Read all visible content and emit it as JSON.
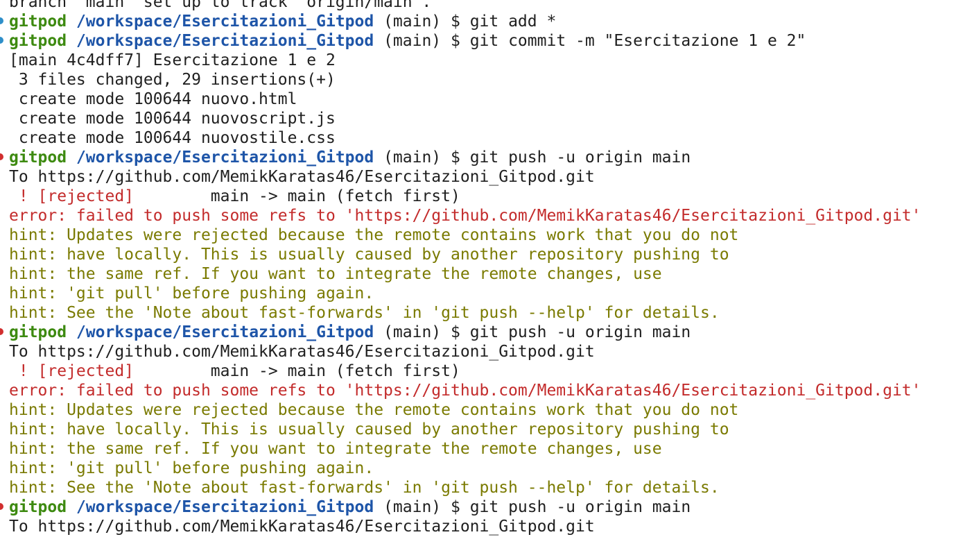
{
  "lines": [
    {
      "kind": "output",
      "text": "branch 'main' set up to track 'origin/main'."
    },
    {
      "kind": "prompt",
      "status": "ok",
      "user": "gitpod",
      "path": "/workspace/Esercitazioni_Gitpod",
      "rest": " (main) $ git add *"
    },
    {
      "kind": "prompt",
      "status": "ok",
      "user": "gitpod",
      "path": "/workspace/Esercitazioni_Gitpod",
      "rest": " (main) $ git commit -m \"Esercitazione 1 e 2\""
    },
    {
      "kind": "output",
      "text": "[main 4c4dff7] Esercitazione 1 e 2"
    },
    {
      "kind": "output",
      "text": " 3 files changed, 29 insertions(+)"
    },
    {
      "kind": "output",
      "text": " create mode 100644 nuovo.html"
    },
    {
      "kind": "output",
      "text": " create mode 100644 nuovoscript.js"
    },
    {
      "kind": "output",
      "text": " create mode 100644 nuovostile.css"
    },
    {
      "kind": "prompt",
      "status": "error",
      "user": "gitpod",
      "path": "/workspace/Esercitazioni_Gitpod",
      "rest": " (main) $ git push -u origin main"
    },
    {
      "kind": "output",
      "text": "To https://github.com/MemikKaratas46/Esercitazioni_Gitpod.git"
    },
    {
      "kind": "rejected",
      "tag": " ! [rejected]",
      "text": "        main -> main (fetch first)"
    },
    {
      "kind": "error",
      "text": "error: failed to push some refs to 'https://github.com/MemikKaratas46/Esercitazioni_Gitpod.git'"
    },
    {
      "kind": "hint",
      "text": "hint: Updates were rejected because the remote contains work that you do not"
    },
    {
      "kind": "hint",
      "text": "hint: have locally. This is usually caused by another repository pushing to"
    },
    {
      "kind": "hint",
      "text": "hint: the same ref. If you want to integrate the remote changes, use"
    },
    {
      "kind": "hint",
      "text": "hint: 'git pull' before pushing again."
    },
    {
      "kind": "hint",
      "text": "hint: See the 'Note about fast-forwards' in 'git push --help' for details."
    },
    {
      "kind": "prompt",
      "status": "error",
      "user": "gitpod",
      "path": "/workspace/Esercitazioni_Gitpod",
      "rest": " (main) $ git push -u origin main"
    },
    {
      "kind": "output",
      "text": "To https://github.com/MemikKaratas46/Esercitazioni_Gitpod.git"
    },
    {
      "kind": "rejected",
      "tag": " ! [rejected]",
      "text": "        main -> main (fetch first)"
    },
    {
      "kind": "error",
      "text": "error: failed to push some refs to 'https://github.com/MemikKaratas46/Esercitazioni_Gitpod.git'"
    },
    {
      "kind": "hint",
      "text": "hint: Updates were rejected because the remote contains work that you do not"
    },
    {
      "kind": "hint",
      "text": "hint: have locally. This is usually caused by another repository pushing to"
    },
    {
      "kind": "hint",
      "text": "hint: the same ref. If you want to integrate the remote changes, use"
    },
    {
      "kind": "hint",
      "text": "hint: 'git pull' before pushing again."
    },
    {
      "kind": "hint",
      "text": "hint: See the 'Note about fast-forwards' in 'git push --help' for details."
    },
    {
      "kind": "prompt",
      "status": "error",
      "user": "gitpod",
      "path": "/workspace/Esercitazioni_Gitpod",
      "rest": " (main) $ git push -u origin main"
    },
    {
      "kind": "output",
      "text": "To https://github.com/MemikKaratas46/Esercitazioni_Gitpod.git"
    }
  ]
}
